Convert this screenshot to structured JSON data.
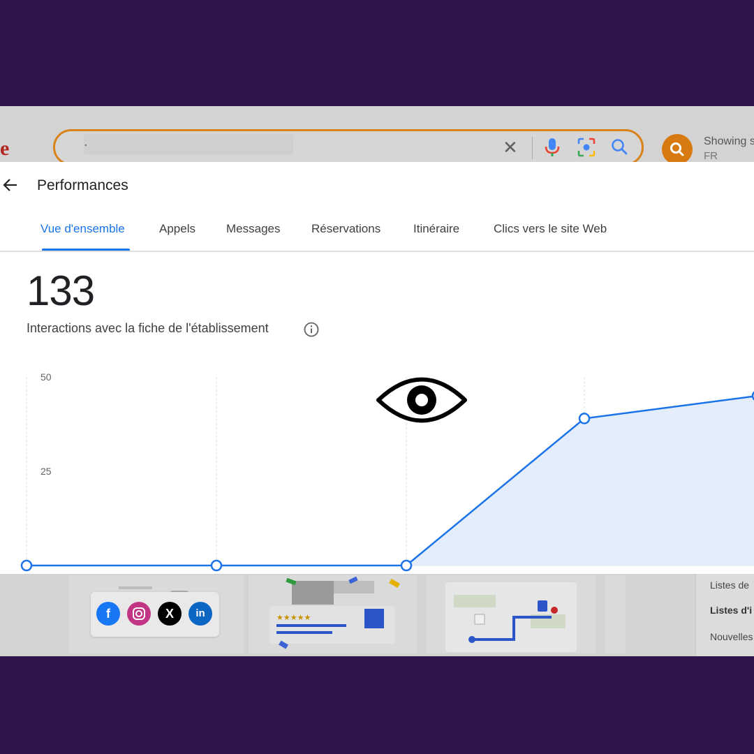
{
  "search": {
    "logo_fragment": "e",
    "query_text": ".",
    "showing_text": "Showing s",
    "region": "FR"
  },
  "panel": {
    "title": "Performances",
    "tabs": [
      {
        "label": "Vue d'ensemble",
        "active": true
      },
      {
        "label": "Appels",
        "active": false
      },
      {
        "label": "Messages",
        "active": false
      },
      {
        "label": "Réservations",
        "active": false
      },
      {
        "label": "Itinéraire",
        "active": false
      },
      {
        "label": "Clics vers le site Web",
        "active": false
      }
    ],
    "total": "133",
    "total_label": "Interactions avec la fiche de l'établissement"
  },
  "chart_data": {
    "type": "area",
    "y_ticks": [
      "50",
      "25"
    ],
    "ylim": [
      0,
      50
    ],
    "x": [
      0,
      1,
      2,
      3,
      4
    ],
    "values": [
      0,
      0,
      0,
      39,
      45
    ],
    "color": "#1a73e8",
    "fill": "#e3edfc",
    "grid": true
  },
  "lower": {
    "social_icons": [
      "facebook",
      "instagram",
      "x",
      "linkedin"
    ],
    "list_items": [
      "Listes de",
      "Listes d'i",
      "Nouvelles"
    ]
  },
  "colors": {
    "background": "#2f144c",
    "accent": "#1a73e8",
    "search_border": "#d9821a"
  }
}
